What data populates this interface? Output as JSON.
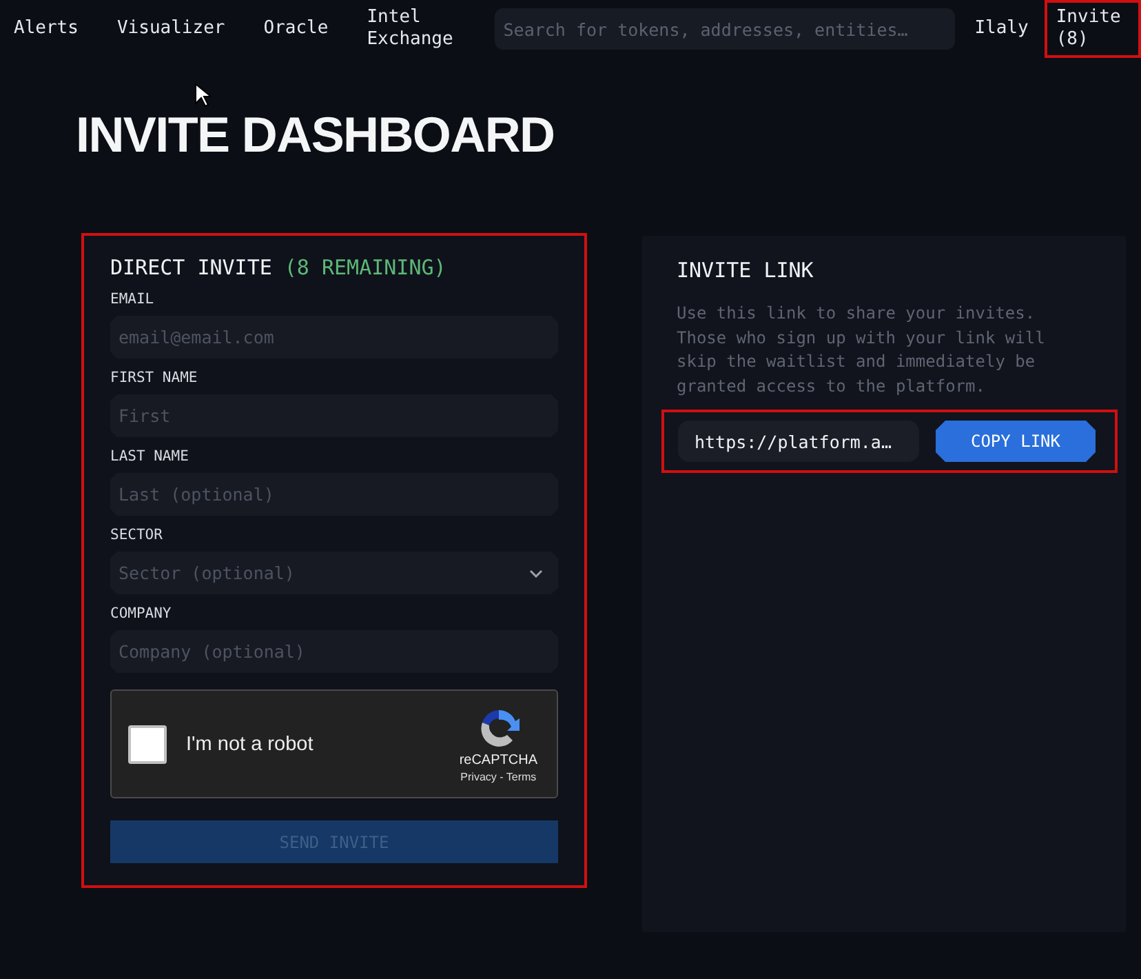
{
  "nav": {
    "items": [
      {
        "label": "Alerts"
      },
      {
        "label": "Visualizer"
      },
      {
        "label": "Oracle"
      },
      {
        "label": "Intel Exchange"
      }
    ],
    "search": {
      "placeholder": "Search for tokens, addresses, entities…"
    },
    "user": "Ilaly",
    "invite": {
      "label": "Invite (8)",
      "highlighted": true
    }
  },
  "title": "INVITE DASHBOARD",
  "direct_invite": {
    "highlighted": true,
    "title": "DIRECT INVITE",
    "remaining": "(8 REMAINING)",
    "fields": [
      {
        "kind": "text",
        "label": "EMAIL",
        "placeholder": "email@email.com"
      },
      {
        "kind": "text",
        "label": "FIRST NAME",
        "placeholder": "First"
      },
      {
        "kind": "text",
        "label": "LAST NAME",
        "placeholder": "Last (optional)"
      },
      {
        "kind": "select",
        "label": "SECTOR",
        "placeholder": "Sector (optional)"
      },
      {
        "kind": "text",
        "label": "COMPANY",
        "placeholder": "Company (optional)"
      }
    ],
    "captcha": {
      "label": "I'm not a robot",
      "checked": false,
      "brand": "reCAPTCHA",
      "links": "Privacy - Terms"
    },
    "submit": {
      "label": "SEND INVITE",
      "disabled": true
    }
  },
  "invite_link": {
    "title": "INVITE LINK",
    "description": "Use this link to share your invites. Those who sign up with your link will skip the waitlist and immediately be granted access to the platform.",
    "url": "https://platform.a…",
    "button": "COPY LINK",
    "highlighted": true
  }
}
